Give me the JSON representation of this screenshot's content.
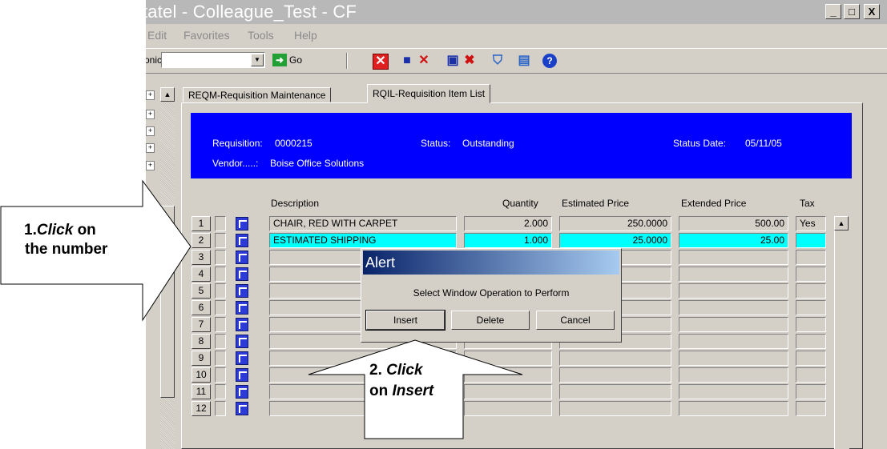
{
  "window": {
    "title": "tatel - Colleague_Test - CF",
    "controls": {
      "minimize": "_",
      "restore": "□",
      "close": "X"
    }
  },
  "menu": [
    "Edit",
    "Favorites",
    "Tools",
    "Help"
  ],
  "toolbar": {
    "label": "onic",
    "combo_value": "",
    "go_label": "Go",
    "icons": [
      "cancel-x-icon",
      "save-icon",
      "delete-icon",
      "save-copy-icon",
      "delete-record-icon",
      "trash-icon",
      "list-icon",
      "help-icon"
    ]
  },
  "tabs": [
    {
      "label": "REQM-Requisition Maintenance",
      "active": false
    },
    {
      "label": "RQIL-Requisition Item List",
      "active": true
    }
  ],
  "header": {
    "requisition_label": "Requisition:",
    "requisition_value": "0000215",
    "vendor_label": "Vendor.....:",
    "vendor_value": "Boise Office Solutions",
    "status_label": "Status:",
    "status_value": "Outstanding",
    "status_date_label": "Status Date:",
    "status_date_value": "05/11/05"
  },
  "grid": {
    "columns": [
      "Description",
      "Quantity",
      "Estimated Price",
      "Extended Price",
      "Tax"
    ],
    "rows": [
      {
        "num": "1",
        "description": "CHAIR, RED WITH CARPET",
        "quantity": "2.000",
        "estimated_price": "250.0000",
        "extended_price": "500.00",
        "tax": "Yes"
      },
      {
        "num": "2",
        "description": "ESTIMATED SHIPPING",
        "quantity": "1.000",
        "estimated_price": "25.0000",
        "extended_price": "25.00",
        "tax": ""
      },
      {
        "num": "3",
        "description": "",
        "quantity": "",
        "estimated_price": "",
        "extended_price": "",
        "tax": ""
      },
      {
        "num": "4",
        "description": "",
        "quantity": "",
        "estimated_price": "",
        "extended_price": "",
        "tax": ""
      },
      {
        "num": "5",
        "description": "",
        "quantity": "",
        "estimated_price": "",
        "extended_price": "",
        "tax": ""
      },
      {
        "num": "6",
        "description": "",
        "quantity": "",
        "estimated_price": "",
        "extended_price": "",
        "tax": ""
      },
      {
        "num": "7",
        "description": "",
        "quantity": "",
        "estimated_price": "",
        "extended_price": "",
        "tax": ""
      },
      {
        "num": "8",
        "description": "",
        "quantity": "",
        "estimated_price": "",
        "extended_price": "",
        "tax": ""
      },
      {
        "num": "9",
        "description": "",
        "quantity": "",
        "estimated_price": "",
        "extended_price": "",
        "tax": ""
      },
      {
        "num": "10",
        "description": "",
        "quantity": "",
        "estimated_price": "",
        "extended_price": "",
        "tax": ""
      },
      {
        "num": "11",
        "description": "",
        "quantity": "",
        "estimated_price": "",
        "extended_price": "",
        "tax": ""
      },
      {
        "num": "12",
        "description": "",
        "quantity": "",
        "estimated_price": "",
        "extended_price": "",
        "tax": ""
      }
    ],
    "selected_row": 2,
    "selection_color": "#00ffff"
  },
  "alert": {
    "title": "Alert",
    "message": "Select Window Operation to Perform",
    "buttons": [
      "Insert",
      "Delete",
      "Cancel"
    ]
  },
  "callouts": {
    "step1_number": "1.",
    "step1_action": "Click",
    "step1_rest": "on",
    "step1_line2": "the number",
    "step2_number": "2.",
    "step2_action": "Click",
    "step2_on": "on",
    "step2_target": "Insert"
  },
  "colors": {
    "header_panel": "#0000ff",
    "window_chrome": "#d4d0c8",
    "title_gradient_start": "#0a246a"
  }
}
